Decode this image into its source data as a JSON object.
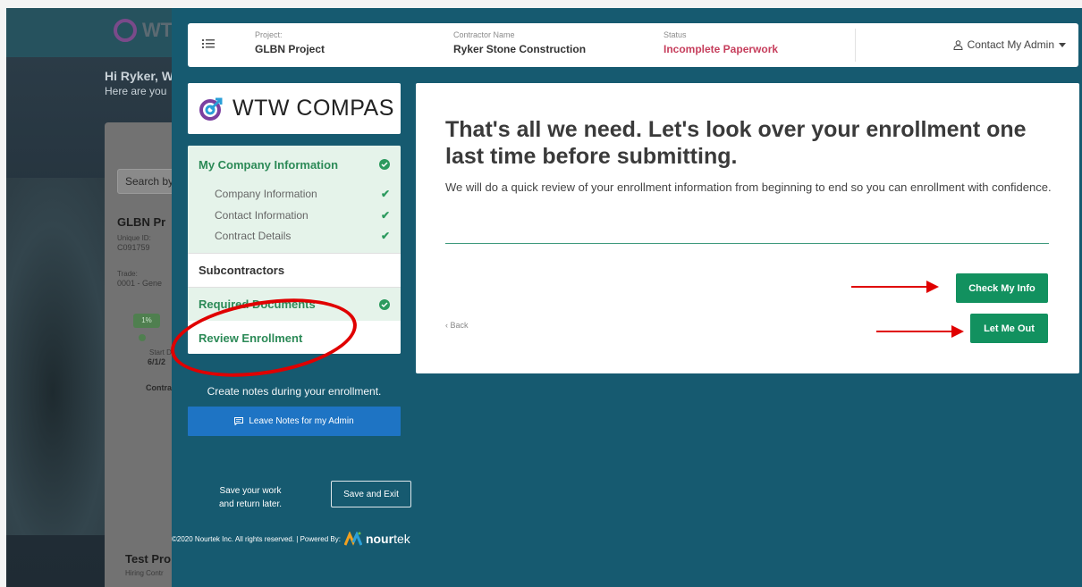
{
  "background_app": {
    "logo_text": "WT",
    "greeting_title": "Hi Ryker, W",
    "greeting_sub": "Here are you",
    "search_placeholder": "Search by",
    "project_title": "GLBN Pr",
    "unique_id_label": "Unique ID:",
    "unique_id_value": "C091759",
    "trade_label": "Trade:",
    "trade_value": "0001 - Gene",
    "percent": "1%",
    "start_date_label": "Start Date",
    "start_date_value": "6/1/2",
    "contract_label": "Contract",
    "test_project": "Test Pro",
    "hiring_label": "Hiring Contr"
  },
  "topbar": {
    "project_label": "Project:",
    "project_value": "GLBN Project",
    "contractor_label": "Contractor Name",
    "contractor_value": "Ryker Stone Construction",
    "status_label": "Status",
    "status_value": "Incomplete Paperwork",
    "contact_label": "Contact My Admin"
  },
  "sidebar": {
    "logo_text": "WTW COMPAS",
    "section_title": "My Company Information",
    "sub_items": [
      {
        "label": "Company Information"
      },
      {
        "label": "Contact Information"
      },
      {
        "label": "Contract Details"
      }
    ],
    "subcontractors": "Subcontractors",
    "required_documents": "Required Documents",
    "review_enrollment": "Review Enrollment",
    "notes_prompt": "Create notes during your enrollment.",
    "notes_button": "Leave Notes for my Admin",
    "save_line1": "Save your work",
    "save_line2": "and return later.",
    "save_button": "Save and Exit"
  },
  "footer": {
    "copyright": "©2020 Nourtek Inc. All rights reserved.  |  Powered By:",
    "brand_a": "nour",
    "brand_b": "tek"
  },
  "main": {
    "title": "That's all we need. Let's look over your enrollment one last time before submitting.",
    "body": "We will do a quick review of your enrollment information from beginning to end so you can enrollment with confidence.",
    "back": "Back",
    "check_button": "Check My Info",
    "out_button": "Let Me Out"
  },
  "colors": {
    "overlay": "#165a70",
    "accent_green": "#12915f",
    "status_red": "#c63e5c",
    "notes_blue": "#1e74c4",
    "annotation_red": "#e00000"
  }
}
